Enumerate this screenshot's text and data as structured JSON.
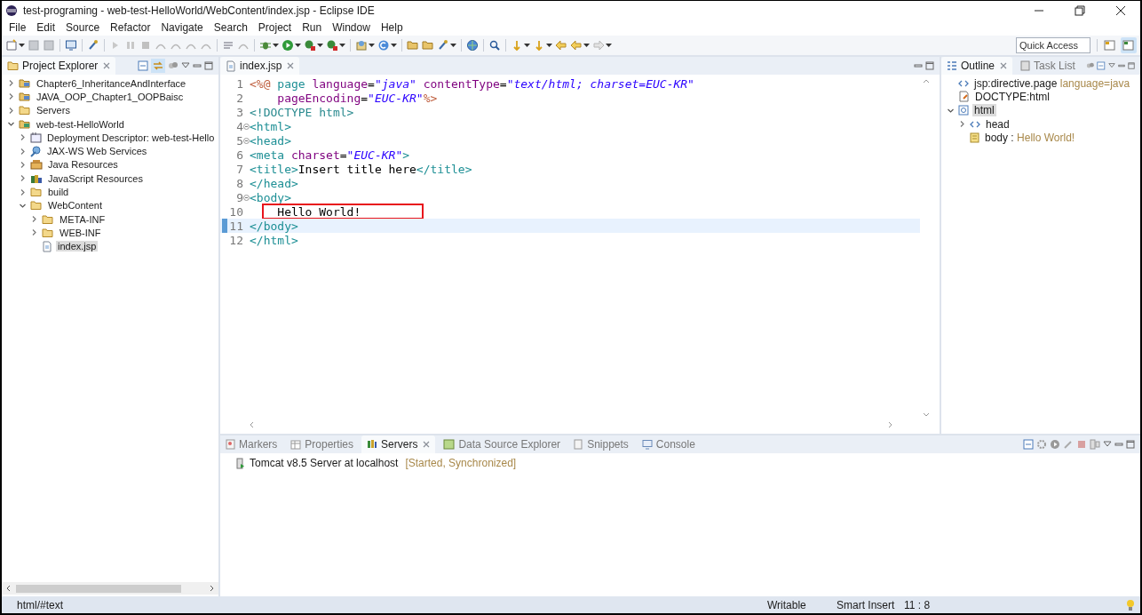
{
  "window": {
    "title": "test-programing - web-test-HelloWorld/WebContent/index.jsp - Eclipse IDE"
  },
  "menu": [
    "File",
    "Edit",
    "Source",
    "Refactor",
    "Navigate",
    "Search",
    "Project",
    "Run",
    "Window",
    "Help"
  ],
  "quick_access": {
    "placeholder": "Quick Access"
  },
  "perspectives": [
    {
      "selected": false
    },
    {
      "selected": true
    }
  ],
  "project_explorer": {
    "tab": {
      "label": "Project Explorer"
    },
    "items": [
      {
        "label": "Chapter6_InheritanceAndInterface",
        "kind": "project",
        "expanded": false,
        "selected": false
      },
      {
        "label": "JAVA_OOP_Chapter1_OOPBaisc",
        "kind": "project",
        "expanded": false,
        "selected": false
      },
      {
        "label": "Servers",
        "kind": "folder",
        "expanded": false,
        "selected": false
      },
      {
        "label": "web-test-HelloWorld",
        "kind": "webproject",
        "expanded": true,
        "selected": false,
        "children": [
          {
            "label": "Deployment Descriptor: web-test-Hello",
            "kind": "descriptor",
            "expanded": false,
            "selected": false
          },
          {
            "label": "JAX-WS Web Services",
            "kind": "webservice",
            "expanded": false,
            "selected": false
          },
          {
            "label": "Java Resources",
            "kind": "javares",
            "expanded": false,
            "selected": false
          },
          {
            "label": "JavaScript Resources",
            "kind": "jsres",
            "expanded": false,
            "selected": false
          },
          {
            "label": "build",
            "kind": "folder",
            "expanded": false,
            "selected": false
          },
          {
            "label": "WebContent",
            "kind": "folder",
            "expanded": true,
            "selected": false,
            "children": [
              {
                "label": "META-INF",
                "kind": "folder",
                "expanded": false,
                "selected": false
              },
              {
                "label": "WEB-INF",
                "kind": "folder",
                "expanded": false,
                "selected": false
              },
              {
                "label": "index.jsp",
                "kind": "file",
                "selected": true
              }
            ]
          }
        ]
      }
    ]
  },
  "editor": {
    "tab": {
      "label": "index.jsp"
    },
    "lines": [
      {
        "number": "1",
        "fold": false,
        "current": false,
        "highlight": false,
        "tokens": [
          {
            "kind": "delim",
            "text": "<%@"
          },
          {
            "kind": "tag",
            "text": " page"
          },
          {
            "kind": "attr",
            "text": " language"
          },
          {
            "kind": "plain",
            "text": "="
          },
          {
            "kind": "value",
            "text": "\"java\""
          },
          {
            "kind": "attr",
            "text": " contentType"
          },
          {
            "kind": "plain",
            "text": "="
          },
          {
            "kind": "value",
            "text": "\"text/html; charset=EUC-KR\""
          }
        ]
      },
      {
        "number": "2",
        "fold": false,
        "current": false,
        "highlight": false,
        "tokens": [
          {
            "kind": "attr",
            "text": "    pageEncoding"
          },
          {
            "kind": "plain",
            "text": "="
          },
          {
            "kind": "value",
            "text": "\"EUC-KR\""
          },
          {
            "kind": "delim",
            "text": "%>"
          }
        ]
      },
      {
        "number": "3",
        "fold": false,
        "current": false,
        "highlight": false,
        "tokens": [
          {
            "kind": "doctype",
            "text": "<!DOCTYPE html>"
          }
        ]
      },
      {
        "number": "4",
        "fold": true,
        "current": false,
        "highlight": false,
        "tokens": [
          {
            "kind": "tag",
            "text": "<html>"
          }
        ]
      },
      {
        "number": "5",
        "fold": true,
        "current": false,
        "highlight": false,
        "tokens": [
          {
            "kind": "tag",
            "text": "<head>"
          }
        ]
      },
      {
        "number": "6",
        "fold": false,
        "current": false,
        "highlight": false,
        "tokens": [
          {
            "kind": "tag",
            "text": "<meta"
          },
          {
            "kind": "attr",
            "text": " charset"
          },
          {
            "kind": "plain",
            "text": "="
          },
          {
            "kind": "value",
            "text": "\"EUC-KR\""
          },
          {
            "kind": "tag",
            "text": ">"
          }
        ]
      },
      {
        "number": "7",
        "fold": false,
        "current": false,
        "highlight": false,
        "tokens": [
          {
            "kind": "tag",
            "text": "<title>"
          },
          {
            "kind": "text",
            "text": "Insert title here"
          },
          {
            "kind": "tag",
            "text": "</title>"
          }
        ]
      },
      {
        "number": "8",
        "fold": false,
        "current": false,
        "highlight": false,
        "tokens": [
          {
            "kind": "tag",
            "text": "</head>"
          }
        ]
      },
      {
        "number": "9",
        "fold": true,
        "current": false,
        "highlight": false,
        "tokens": [
          {
            "kind": "tag",
            "text": "<body>"
          }
        ]
      },
      {
        "number": "10",
        "fold": false,
        "current": false,
        "highlight": true,
        "tokens": [
          {
            "kind": "text",
            "text": "    Hello World!"
          }
        ]
      },
      {
        "number": "11",
        "fold": false,
        "current": true,
        "highlight": false,
        "tokens": [
          {
            "kind": "tag",
            "text": "</body>"
          }
        ]
      },
      {
        "number": "12",
        "fold": false,
        "current": false,
        "highlight": false,
        "tokens": [
          {
            "kind": "tag",
            "text": "</html>"
          }
        ]
      }
    ]
  },
  "outline": {
    "tabs": [
      {
        "label": "Outline",
        "kind": "outline",
        "selected": true
      },
      {
        "label": "Task List",
        "kind": "tasks",
        "selected": false
      }
    ],
    "items": [
      {
        "label": "jsp:directive.page",
        "detail": "language=java",
        "kind": "directive",
        "selected": false
      },
      {
        "label": "DOCTYPE:html",
        "kind": "doctype",
        "selected": false
      },
      {
        "label": "html",
        "kind": "element",
        "expanded": true,
        "selected": true,
        "children": [
          {
            "label": "head",
            "kind": "directive",
            "expanded": false,
            "selected": false
          },
          {
            "label": "body :",
            "detail": "Hello World!",
            "kind": "body",
            "selected": false
          }
        ]
      }
    ]
  },
  "bottom": {
    "tabs": [
      {
        "label": "Markers",
        "kind": "markers",
        "selected": false
      },
      {
        "label": "Properties",
        "kind": "properties",
        "selected": false
      },
      {
        "label": "Servers",
        "kind": "servers",
        "selected": true
      },
      {
        "label": "Data Source Explorer",
        "kind": "datasource",
        "selected": false
      },
      {
        "label": "Snippets",
        "kind": "snippets",
        "selected": false
      },
      {
        "label": "Console",
        "kind": "console",
        "selected": false
      }
    ],
    "servers": [
      {
        "name": "Tomcat v8.5 Server at localhost",
        "status": "[Started, Synchronized]"
      }
    ]
  },
  "status_bar": {
    "context": "html/#text",
    "mode": "Writable",
    "insert": "Smart Insert",
    "position": "11 : 8"
  }
}
